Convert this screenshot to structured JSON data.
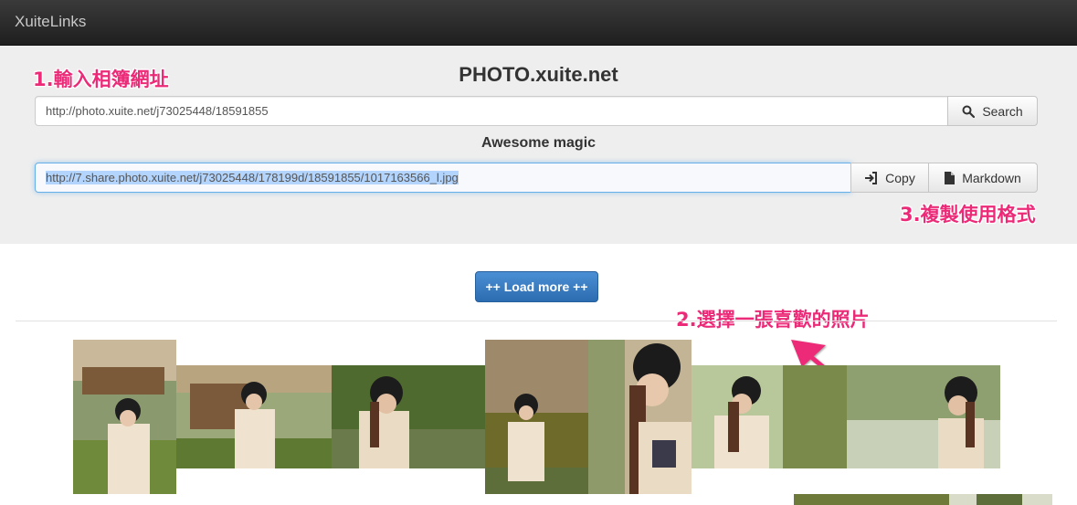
{
  "navbar": {
    "brand": "XuiteLinks"
  },
  "hero": {
    "title": "PHOTO.xuite.net",
    "subtitle": "Awesome magic",
    "search": {
      "value": "http://photo.xuite.net/j73025448/18591855",
      "button_label": "Search",
      "icon": "search-icon"
    },
    "result": {
      "value": "http://7.share.photo.xuite.net/j73025448/178199d/18591855/1017163566_l.jpg",
      "copy_label": "Copy",
      "copy_icon": "sign-in-icon",
      "markdown_label": "Markdown",
      "markdown_icon": "file-icon"
    }
  },
  "annotations": {
    "step1": "1.輸入相簿網址",
    "step2": "2.選擇一張喜歡的照片",
    "step3": "3.複製使用格式",
    "color": "#ec2b78"
  },
  "load_more": {
    "label": "++ Load more ++"
  },
  "colors": {
    "accent": "#337ab7",
    "navbar": "#222222",
    "hero_bg": "#eeeeee"
  }
}
